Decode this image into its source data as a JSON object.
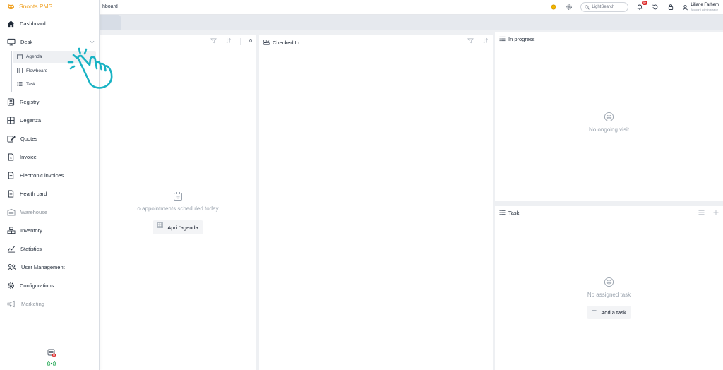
{
  "app": {
    "brand": "Snoots PMS",
    "accent": "#f0a020",
    "cursor_color": "#19b3c4"
  },
  "header": {
    "breadcrumb": "hboard",
    "search_placeholder": "LightSearch",
    "notification_badge": "9+",
    "user_name": "Liliane Farhem",
    "user_role": "Account administrator"
  },
  "sidebar": {
    "dashboard": "Dashboard",
    "desk": "Desk",
    "desk_children": {
      "agenda": "Agenda",
      "flowboard": "Flowboard",
      "task": "Task"
    },
    "registry": "Registry",
    "degenza": "Degenza",
    "quotes": "Quotes",
    "invoice": "Invoice",
    "electronic_invoices": "Electronic invoices",
    "health_card": "Health card",
    "warehouse": "Warehouse",
    "inventory": "Inventory",
    "statistics": "Statistics",
    "user_management": "User Management",
    "configurations": "Configurations",
    "marketing": "Marketing"
  },
  "columns": {
    "appointments": {
      "count": "0",
      "empty_text": "o appointments scheduled today",
      "button_label": "Apri l'agenda"
    },
    "checked_in": {
      "title": "Checked In"
    },
    "in_progress": {
      "title": "In progress",
      "empty_text": "No ongoing visit"
    },
    "task": {
      "title": "Task",
      "empty_text": "No assigned task",
      "button_label": "Add a task"
    }
  }
}
